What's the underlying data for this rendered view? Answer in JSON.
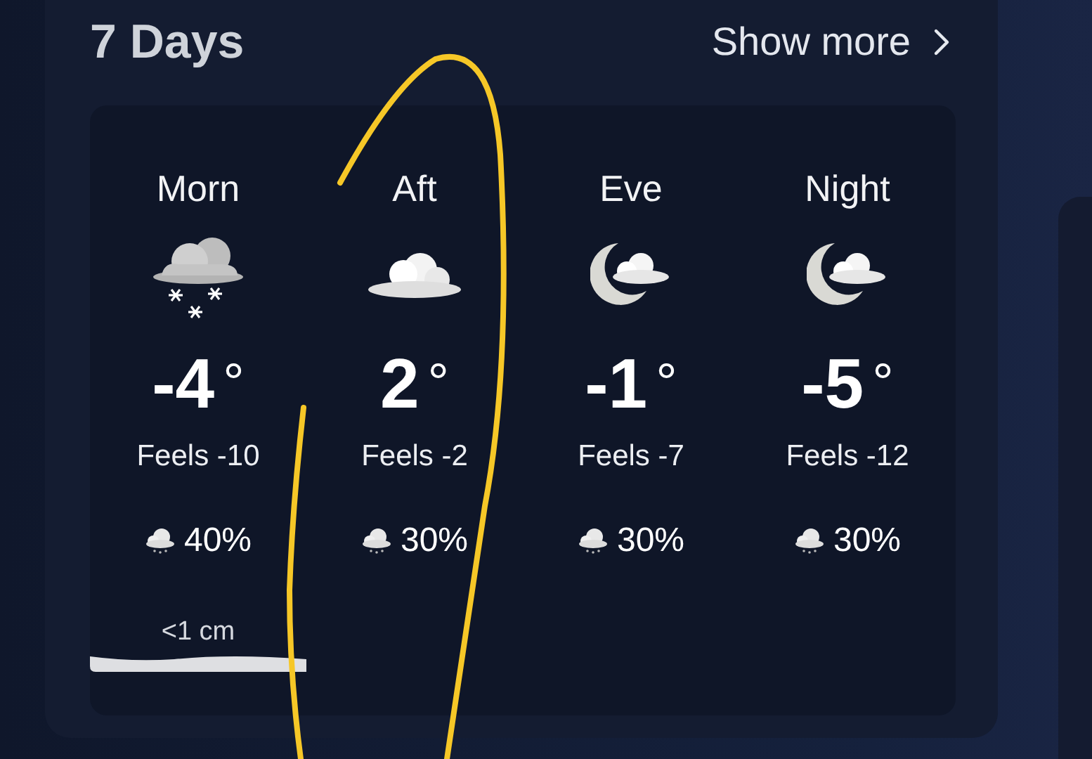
{
  "header": {
    "title": "7 Days",
    "link": "Show more"
  },
  "periods": [
    {
      "label": "Morn",
      "icon": {
        "kind": "snow"
      },
      "temp": "-4",
      "unit": "°",
      "feels": "Feels -10",
      "precip": "40%",
      "snow": "<1 cm"
    },
    {
      "label": "Aft",
      "icon": {
        "kind": "cloudy"
      },
      "temp": "2",
      "unit": "°",
      "feels": "Feels -2",
      "precip": "30%"
    },
    {
      "label": "Eve",
      "icon": {
        "kind": "night-cloudy"
      },
      "temp": "-1",
      "unit": "°",
      "feels": "Feels -7",
      "precip": "30%"
    },
    {
      "label": "Night",
      "icon": {
        "kind": "night-cloudy"
      },
      "temp": "-5",
      "unit": "°",
      "feels": "Feels -12",
      "precip": "30%"
    }
  ],
  "annotation": {
    "kind": "circle",
    "color": "#f6c727"
  }
}
